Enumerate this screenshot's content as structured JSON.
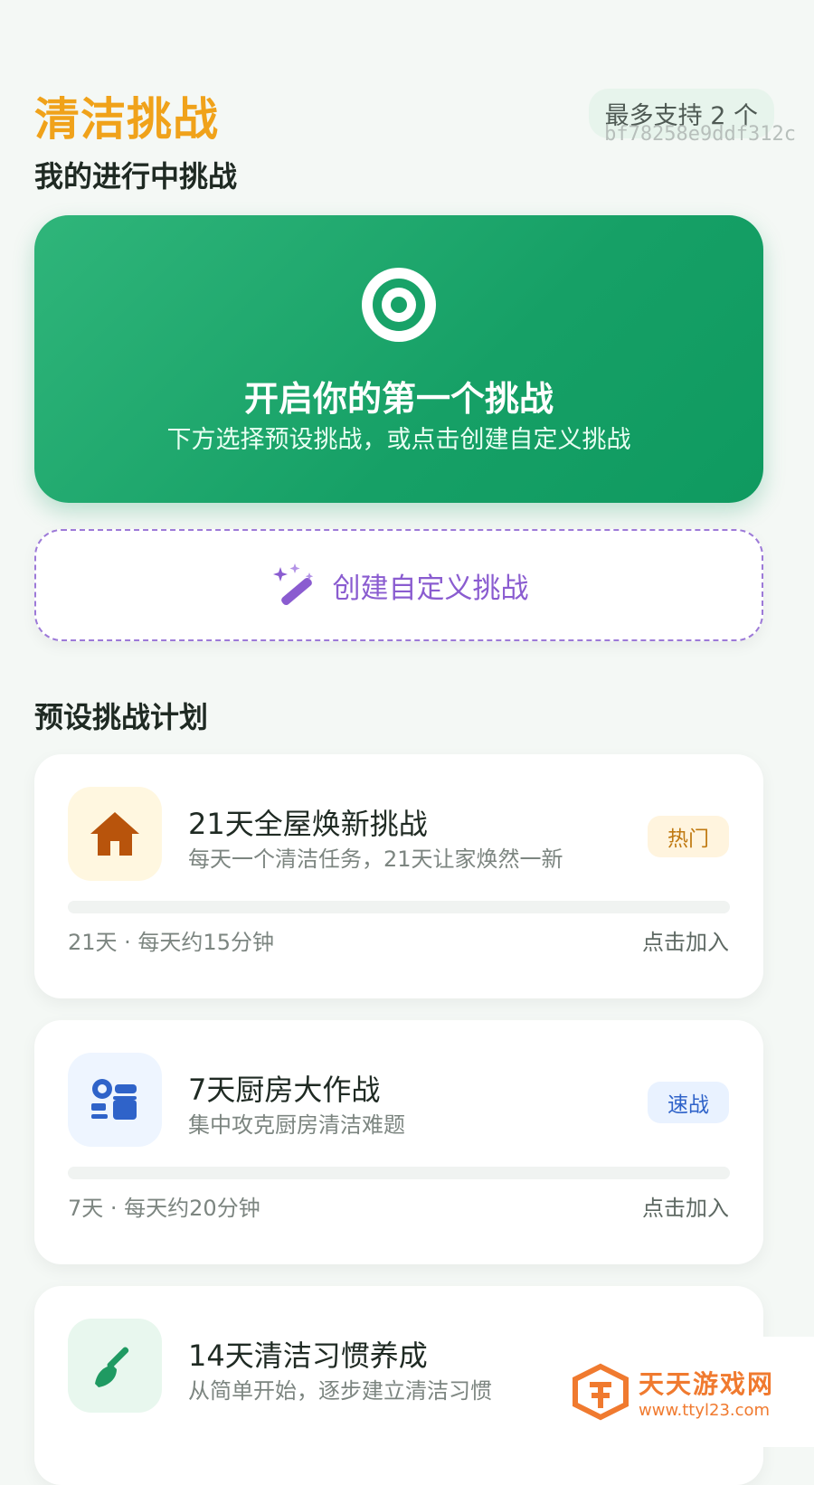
{
  "header": {
    "title": "清洁挑战",
    "limit_label": "最多支持 2 个",
    "hash": "bf78258e9ddf312c"
  },
  "sections": {
    "in_progress": "我的进行中挑战",
    "presets": "预设挑战计划"
  },
  "hero": {
    "icon": "target-icon",
    "heading": "开启你的第一个挑战",
    "subtitle": "下方选择预设挑战，或点击创建自定义挑战"
  },
  "create": {
    "icon": "magic-wand-icon",
    "label": "创建自定义挑战"
  },
  "plans": [
    {
      "icon": "house-icon",
      "name": "21天全屋焕新挑战",
      "desc": "每天一个清洁任务，21天让家焕然一新",
      "badge": "热门",
      "meta": "21天 · 每天约15分钟",
      "join": "点击加入"
    },
    {
      "icon": "kitchen-icon",
      "name": "7天厨房大作战",
      "desc": "集中攻克厨房清洁难题",
      "badge": "速战",
      "meta": "7天 · 每天约20分钟",
      "join": "点击加入"
    },
    {
      "icon": "broom-icon",
      "name": "14天清洁习惯养成",
      "desc": "从简单开始，逐步建立清洁习惯"
    }
  ],
  "watermark": {
    "name": "天天游戏网",
    "url": "www.ttyl23.com"
  },
  "colors": {
    "title": "#f0a21a",
    "hero_green": "#16a066",
    "purple": "#8a5cd0",
    "hot_badge_bg": "#fff4de",
    "hot_badge_text": "#c07a12",
    "speed_badge_bg": "#e9f2ff",
    "speed_badge_text": "#2f63c9"
  }
}
